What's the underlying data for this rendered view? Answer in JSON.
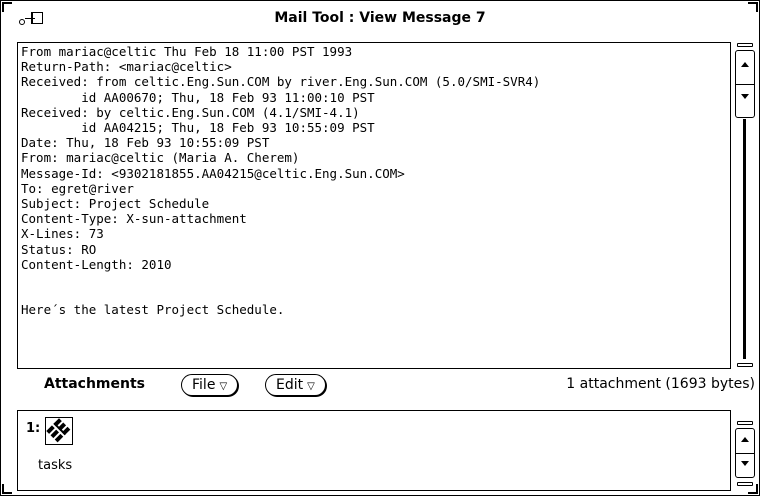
{
  "window": {
    "title": "Mail Tool : View Message 7"
  },
  "message": {
    "lines": [
      "From mariac@celtic Thu Feb 18 11:00 PST 1993",
      "Return-Path: <mariac@celtic>",
      "Received: from celtic.Eng.Sun.COM by river.Eng.Sun.COM (5.0/SMI-SVR4)",
      "        id AA00670; Thu, 18 Feb 93 11:00:10 PST",
      "Received: by celtic.Eng.Sun.COM (4.1/SMI-4.1)",
      "        id AA04215; Thu, 18 Feb 93 10:55:09 PST",
      "Date: Thu, 18 Feb 93 10:55:09 PST",
      "From: mariac@celtic (Maria A. Cherem)",
      "Message-Id: <9302181855.AA04215@celtic.Eng.Sun.COM>",
      "To: egret@river",
      "Subject: Project Schedule",
      "Content-Type: X-sun-attachment",
      "X-Lines: 73",
      "Status: RO",
      "Content-Length: 2010",
      "",
      "",
      "Here´s the latest Project Schedule."
    ]
  },
  "attachments_bar": {
    "label": "Attachments",
    "file_button": "File",
    "edit_button": "Edit",
    "menu_glyph": "▽",
    "summary": "1 attachment (1693 bytes)"
  },
  "attachment_list": [
    {
      "number": "1:",
      "name": "tasks",
      "icon": "sun-logo-icon"
    }
  ]
}
